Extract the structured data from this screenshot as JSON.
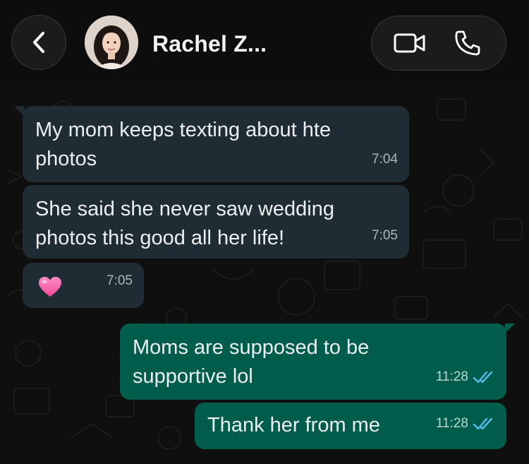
{
  "header": {
    "contact_name": "Rachel Z...",
    "back_icon": "chevron-left-icon",
    "video_icon": "video-camera-icon",
    "call_icon": "phone-icon"
  },
  "messages": [
    {
      "direction": "incoming",
      "text": "My mom keeps texting about hte photos",
      "time": "7:04"
    },
    {
      "direction": "incoming",
      "text": "She said she never saw wedding photos this good all her life!",
      "time": "7:05"
    },
    {
      "direction": "incoming",
      "emoji": "💗",
      "time": "7:05",
      "icon": "pink-heart-icon"
    },
    {
      "direction": "outgoing",
      "text": "Moms are supposed to be supportive lol",
      "time": "11:28",
      "status": "read",
      "status_icon": "double-check-icon"
    },
    {
      "direction": "outgoing",
      "text": "Thank her from me",
      "time": "11:28",
      "status": "read",
      "status_icon": "double-check-icon"
    }
  ],
  "colors": {
    "incoming_bubble": "#202c33",
    "outgoing_bubble": "#005c4b",
    "read_ticks": "#53bdeb",
    "background": "#0f0f0f"
  }
}
